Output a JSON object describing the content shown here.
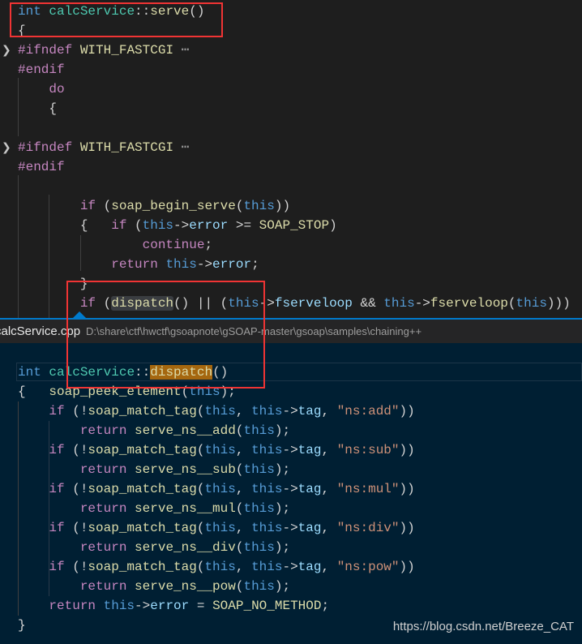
{
  "colors": {
    "keyword": "#569cd6",
    "control": "#c586c0",
    "type": "#4ec9b0",
    "function": "#dcdcaa",
    "variable": "#9cdcfe",
    "string": "#ce9178",
    "accent": "#007acc",
    "highlight_box": "#f03434",
    "peek_background": "#001f33"
  },
  "top_editor": {
    "lines": [
      {
        "fold": false,
        "tokens": [
          [
            "int",
            "k"
          ],
          [
            " ",
            ""
          ],
          [
            "calcService",
            "t"
          ],
          [
            "::",
            ""
          ],
          [
            "serve",
            "f"
          ],
          [
            "()",
            ""
          ]
        ]
      },
      {
        "fold": false,
        "tokens": [
          [
            "{",
            ""
          ]
        ]
      },
      {
        "fold": true,
        "tokens": [
          [
            "#ifndef",
            "p"
          ],
          [
            " ",
            ""
          ],
          [
            "WITH_FASTCGI",
            "m"
          ],
          [
            " ⋯",
            "e"
          ]
        ]
      },
      {
        "fold": false,
        "tokens": [
          [
            "#endif",
            "p"
          ]
        ]
      },
      {
        "fold": false,
        "tokens": [
          [
            "    ",
            ""
          ],
          [
            "do",
            "c"
          ]
        ]
      },
      {
        "fold": false,
        "tokens": [
          [
            "    {",
            ""
          ]
        ]
      },
      {
        "fold": false,
        "tokens": []
      },
      {
        "fold": true,
        "tokens": [
          [
            "#ifndef",
            "p"
          ],
          [
            " ",
            ""
          ],
          [
            "WITH_FASTCGI",
            "m"
          ],
          [
            " ⋯",
            "e"
          ]
        ]
      },
      {
        "fold": false,
        "tokens": [
          [
            "#endif",
            "p"
          ]
        ]
      },
      {
        "fold": false,
        "tokens": []
      },
      {
        "fold": false,
        "tokens": [
          [
            "        ",
            ""
          ],
          [
            "if",
            "c"
          ],
          [
            " (",
            ""
          ],
          [
            "soap_begin_serve",
            "f"
          ],
          [
            "(",
            ""
          ],
          [
            "this",
            "k"
          ],
          [
            "))",
            ""
          ]
        ]
      },
      {
        "fold": false,
        "tokens": [
          [
            "        {   ",
            ""
          ],
          [
            "if",
            "c"
          ],
          [
            " (",
            ""
          ],
          [
            "this",
            "k"
          ],
          [
            "->",
            ""
          ],
          [
            "error",
            "v"
          ],
          [
            " >= ",
            ""
          ],
          [
            "SOAP_STOP",
            "m"
          ],
          [
            ")",
            ""
          ]
        ]
      },
      {
        "fold": false,
        "tokens": [
          [
            "                ",
            ""
          ],
          [
            "continue",
            "c"
          ],
          [
            ";",
            ""
          ]
        ]
      },
      {
        "fold": false,
        "tokens": [
          [
            "            ",
            ""
          ],
          [
            "return",
            "c"
          ],
          [
            " ",
            ""
          ],
          [
            "this",
            "k"
          ],
          [
            "->",
            ""
          ],
          [
            "error",
            "v"
          ],
          [
            ";",
            ""
          ]
        ]
      },
      {
        "fold": false,
        "tokens": [
          [
            "        }",
            ""
          ]
        ]
      },
      {
        "fold": false,
        "tokens": [
          [
            "        ",
            ""
          ],
          [
            "if",
            "c"
          ],
          [
            " (",
            ""
          ],
          [
            "dispatch",
            "f hl"
          ],
          [
            "() || (",
            ""
          ],
          [
            "this",
            "k"
          ],
          [
            "->",
            ""
          ],
          [
            "fserveloop",
            "v"
          ],
          [
            " && ",
            ""
          ],
          [
            "this",
            "k"
          ],
          [
            "->",
            ""
          ],
          [
            "fserveloop",
            "f"
          ],
          [
            "(",
            ""
          ],
          [
            "this",
            "k"
          ],
          [
            ")))",
            ""
          ]
        ]
      }
    ]
  },
  "peek": {
    "file_name": "calcService.cpp",
    "file_path": "D:\\share\\ctf\\hwctf\\gsoapnote\\gSOAP-master\\gsoap\\samples\\chaining++",
    "lines": [
      {
        "tokens": [
          [
            "int",
            "k"
          ],
          [
            " ",
            ""
          ],
          [
            "calcService",
            "t"
          ],
          [
            "::",
            ""
          ],
          [
            "dispatch",
            "f match"
          ],
          [
            "()",
            ""
          ]
        ]
      },
      {
        "tokens": [
          [
            "{   ",
            ""
          ],
          [
            "soap_peek_element",
            "f"
          ],
          [
            "(",
            ""
          ],
          [
            "this",
            "k"
          ],
          [
            ");",
            ""
          ]
        ]
      },
      {
        "tokens": [
          [
            "    ",
            ""
          ],
          [
            "if",
            "c"
          ],
          [
            " (!",
            ""
          ],
          [
            "soap_match_tag",
            "f"
          ],
          [
            "(",
            ""
          ],
          [
            "this",
            "k"
          ],
          [
            ", ",
            ""
          ],
          [
            "this",
            "k"
          ],
          [
            "->",
            ""
          ],
          [
            "tag",
            "v"
          ],
          [
            ", ",
            ""
          ],
          [
            "\"ns:add\"",
            "s"
          ],
          [
            "))",
            ""
          ]
        ]
      },
      {
        "tokens": [
          [
            "        ",
            ""
          ],
          [
            "return",
            "c"
          ],
          [
            " ",
            ""
          ],
          [
            "serve_ns__add",
            "f"
          ],
          [
            "(",
            ""
          ],
          [
            "this",
            "k"
          ],
          [
            ");",
            ""
          ]
        ]
      },
      {
        "tokens": [
          [
            "    ",
            ""
          ],
          [
            "if",
            "c"
          ],
          [
            " (!",
            ""
          ],
          [
            "soap_match_tag",
            "f"
          ],
          [
            "(",
            ""
          ],
          [
            "this",
            "k"
          ],
          [
            ", ",
            ""
          ],
          [
            "this",
            "k"
          ],
          [
            "->",
            ""
          ],
          [
            "tag",
            "v"
          ],
          [
            ", ",
            ""
          ],
          [
            "\"ns:sub\"",
            "s"
          ],
          [
            "))",
            ""
          ]
        ]
      },
      {
        "tokens": [
          [
            "        ",
            ""
          ],
          [
            "return",
            "c"
          ],
          [
            " ",
            ""
          ],
          [
            "serve_ns__sub",
            "f"
          ],
          [
            "(",
            ""
          ],
          [
            "this",
            "k"
          ],
          [
            ");",
            ""
          ]
        ]
      },
      {
        "tokens": [
          [
            "    ",
            ""
          ],
          [
            "if",
            "c"
          ],
          [
            " (!",
            ""
          ],
          [
            "soap_match_tag",
            "f"
          ],
          [
            "(",
            ""
          ],
          [
            "this",
            "k"
          ],
          [
            ", ",
            ""
          ],
          [
            "this",
            "k"
          ],
          [
            "->",
            ""
          ],
          [
            "tag",
            "v"
          ],
          [
            ", ",
            ""
          ],
          [
            "\"ns:mul\"",
            "s"
          ],
          [
            "))",
            ""
          ]
        ]
      },
      {
        "tokens": [
          [
            "        ",
            ""
          ],
          [
            "return",
            "c"
          ],
          [
            " ",
            ""
          ],
          [
            "serve_ns__mul",
            "f"
          ],
          [
            "(",
            ""
          ],
          [
            "this",
            "k"
          ],
          [
            ");",
            ""
          ]
        ]
      },
      {
        "tokens": [
          [
            "    ",
            ""
          ],
          [
            "if",
            "c"
          ],
          [
            " (!",
            ""
          ],
          [
            "soap_match_tag",
            "f"
          ],
          [
            "(",
            ""
          ],
          [
            "this",
            "k"
          ],
          [
            ", ",
            ""
          ],
          [
            "this",
            "k"
          ],
          [
            "->",
            ""
          ],
          [
            "tag",
            "v"
          ],
          [
            ", ",
            ""
          ],
          [
            "\"ns:div\"",
            "s"
          ],
          [
            "))",
            ""
          ]
        ]
      },
      {
        "tokens": [
          [
            "        ",
            ""
          ],
          [
            "return",
            "c"
          ],
          [
            " ",
            ""
          ],
          [
            "serve_ns__div",
            "f"
          ],
          [
            "(",
            ""
          ],
          [
            "this",
            "k"
          ],
          [
            ");",
            ""
          ]
        ]
      },
      {
        "tokens": [
          [
            "    ",
            ""
          ],
          [
            "if",
            "c"
          ],
          [
            " (!",
            ""
          ],
          [
            "soap_match_tag",
            "f"
          ],
          [
            "(",
            ""
          ],
          [
            "this",
            "k"
          ],
          [
            ", ",
            ""
          ],
          [
            "this",
            "k"
          ],
          [
            "->",
            ""
          ],
          [
            "tag",
            "v"
          ],
          [
            ", ",
            ""
          ],
          [
            "\"ns:pow\"",
            "s"
          ],
          [
            "))",
            ""
          ]
        ]
      },
      {
        "tokens": [
          [
            "        ",
            ""
          ],
          [
            "return",
            "c"
          ],
          [
            " ",
            ""
          ],
          [
            "serve_ns__pow",
            "f"
          ],
          [
            "(",
            ""
          ],
          [
            "this",
            "k"
          ],
          [
            ");",
            ""
          ]
        ]
      },
      {
        "tokens": [
          [
            "    ",
            ""
          ],
          [
            "return",
            "c"
          ],
          [
            " ",
            ""
          ],
          [
            "this",
            "k"
          ],
          [
            "->",
            ""
          ],
          [
            "error",
            "v"
          ],
          [
            " = ",
            ""
          ],
          [
            "SOAP_NO_METHOD",
            "m"
          ],
          [
            ";",
            ""
          ]
        ]
      },
      {
        "tokens": [
          [
            "}",
            ""
          ]
        ]
      }
    ]
  },
  "watermark": "https://blog.csdn.net/Breeze_CAT"
}
